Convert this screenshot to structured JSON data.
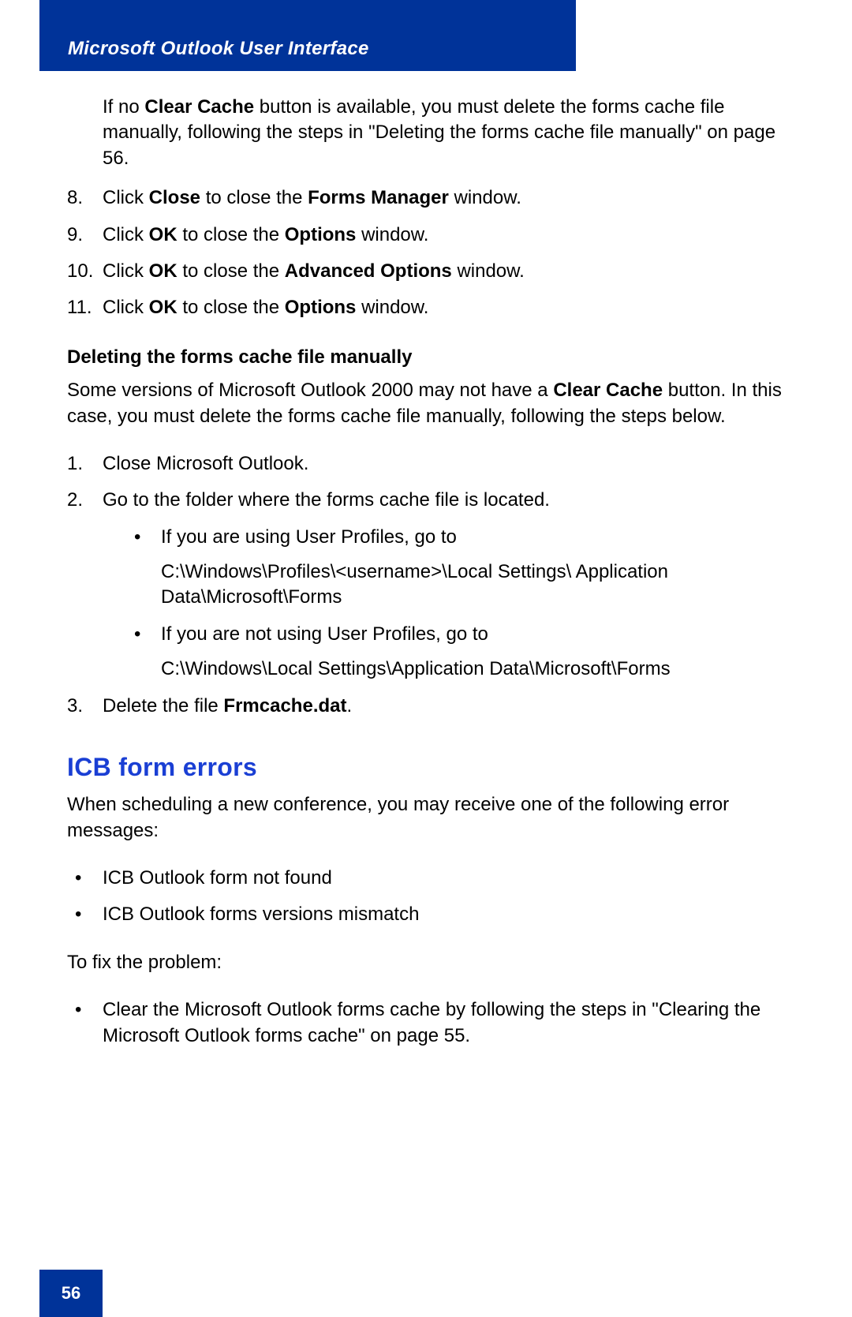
{
  "header": {
    "title": "Microsoft Outlook User Interface"
  },
  "intro": {
    "t1": "If no ",
    "b1": "Clear Cache",
    "t2": " button is available, you must delete the forms cache file manually, following the steps in \"Deleting the forms cache file manually\" on page 56."
  },
  "list1": {
    "i8": {
      "n": "8.",
      "t1": "Click ",
      "b1": "Close",
      "t2": " to close the ",
      "b2": "Forms Manager",
      "t3": " window."
    },
    "i9": {
      "n": "9.",
      "t1": "Click ",
      "b1": "OK",
      "t2": " to close the ",
      "b2": "Options",
      "t3": " window."
    },
    "i10": {
      "n": "10.",
      "t1": "Click ",
      "b1": "OK",
      "t2": " to close the ",
      "b2": "Advanced Options",
      "t3": " window."
    },
    "i11": {
      "n": "11.",
      "t1": "Click ",
      "b1": "OK",
      "t2": " to close the ",
      "b2": "Options",
      "t3": " window."
    }
  },
  "sub1": {
    "heading": "Deleting the forms cache file manually",
    "para_t1": "Some versions of Microsoft Outlook 2000 may not have a ",
    "para_b1": "Clear Cache",
    "para_t2": " button. In this case, you must delete the forms cache file manually, following the steps below."
  },
  "list2": {
    "i1": {
      "n": "1.",
      "t": "Close Microsoft Outlook."
    },
    "i2": {
      "n": "2.",
      "t": "Go to the folder where the forms cache file is located.",
      "b1": {
        "t": "If you are using User Profiles, go to",
        "p": "C:\\Windows\\Profiles\\<username>\\Local Settings\\ Application Data\\Microsoft\\Forms"
      },
      "b2": {
        "t": "If you are not using User Profiles, go to",
        "p": "C:\\Windows\\Local Settings\\Application Data\\Microsoft\\Forms"
      }
    },
    "i3": {
      "n": "3.",
      "t1": "Delete the file ",
      "b1": "Frmcache.dat",
      "t2": "."
    }
  },
  "section2": {
    "heading": "ICB form errors",
    "para": "When scheduling a new conference, you may receive one of the following error messages:",
    "bullets": {
      "b1": "ICB Outlook form not found",
      "b2": "ICB Outlook forms versions mismatch"
    },
    "fix_label": "To fix the problem:",
    "fix_bullet": "Clear the Microsoft Outlook forms cache by following the steps in \"Clearing the Microsoft Outlook forms cache\" on page 55."
  },
  "footer": {
    "page": "56"
  }
}
